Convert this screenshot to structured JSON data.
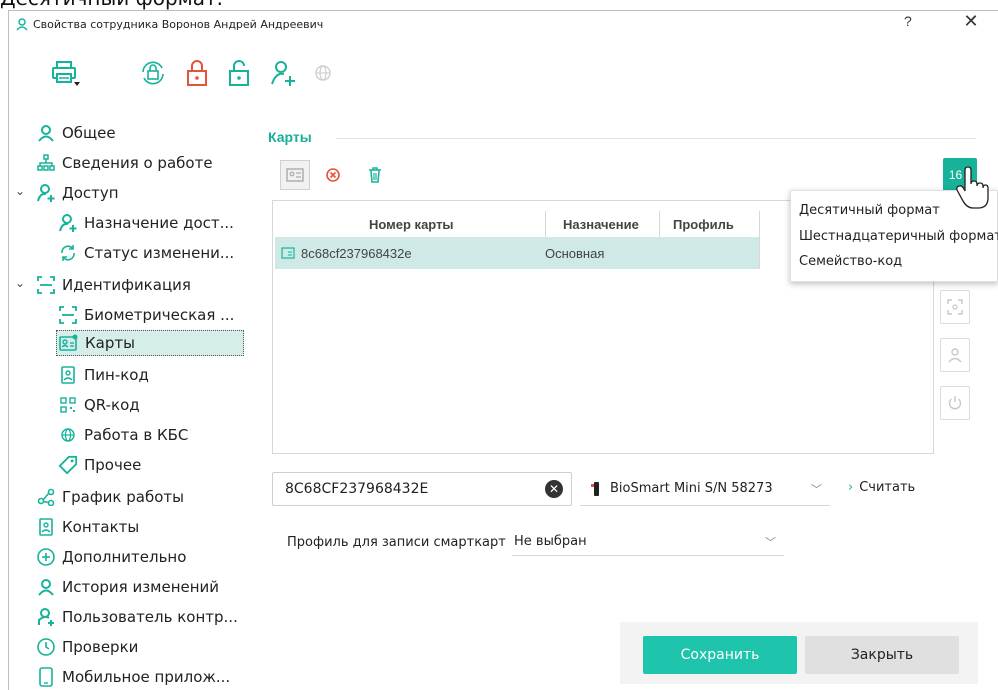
{
  "caption": "Десятичный формат.",
  "window": {
    "title": "Свойства сотрудника Воронов Андрей Андреевич",
    "help": "?",
    "close": "✕"
  },
  "toolbar": {
    "icons": [
      "printer-icon",
      "lock-sync-icon",
      "lock-closed-icon",
      "lock-open-icon",
      "user-add-icon",
      "globe-icon"
    ]
  },
  "sidebar": {
    "items": [
      {
        "label": "Общее",
        "icon": "user-icon"
      },
      {
        "label": "Сведения о работе",
        "icon": "org-chart-icon"
      },
      {
        "label": "Доступ",
        "icon": "user-access-icon"
      },
      {
        "label": "Назначение дост...",
        "icon": "user-assign-icon"
      },
      {
        "label": "Статус изменени...",
        "icon": "sync-icon"
      },
      {
        "label": "Идентификация",
        "icon": "scan-frame-icon"
      },
      {
        "label": "Биометрическая ...",
        "icon": "biometric-icon"
      },
      {
        "label": "Карты",
        "icon": "card-icon"
      },
      {
        "label": "Пин-код",
        "icon": "pin-icon"
      },
      {
        "label": "QR-код",
        "icon": "qr-icon"
      },
      {
        "label": "Работа в КБС",
        "icon": "globe-icon"
      },
      {
        "label": "Прочее",
        "icon": "tag-icon"
      },
      {
        "label": "График работы",
        "icon": "schedule-icon"
      },
      {
        "label": "Контакты",
        "icon": "contacts-icon"
      },
      {
        "label": "Дополнительно",
        "icon": "plus-circle-icon"
      },
      {
        "label": "История изменений",
        "icon": "user-history-icon"
      },
      {
        "label": "Пользователь контр...",
        "icon": "user-control-icon"
      },
      {
        "label": "Проверки",
        "icon": "clock-icon"
      },
      {
        "label": "Мобильное прилож...",
        "icon": "phone-icon"
      }
    ]
  },
  "cards": {
    "section_title": "Карты",
    "columns": [
      "Номер карты",
      "Назначение",
      "Профиль"
    ],
    "rows": [
      {
        "number": "8c68cf237968432e",
        "purpose": "Основная",
        "profile": ""
      }
    ],
    "format_button": "16",
    "format_menu": [
      "Десятичный формат",
      "Шестнадцатеричный формат",
      "Семейство-код"
    ],
    "card_input_value": "8C68CF237968432E",
    "reader": "BioSmart Mini S/N 58273",
    "read_label": "Считать",
    "profile_label": "Профиль для записи смарткарт",
    "profile_value": "Не выбран"
  },
  "footer": {
    "save": "Сохранить",
    "close": "Закрыть"
  },
  "colors": {
    "accent": "#16b39a",
    "save_button": "#1ec4ab",
    "selection": "#cfeae6",
    "danger": "#e8513a"
  }
}
